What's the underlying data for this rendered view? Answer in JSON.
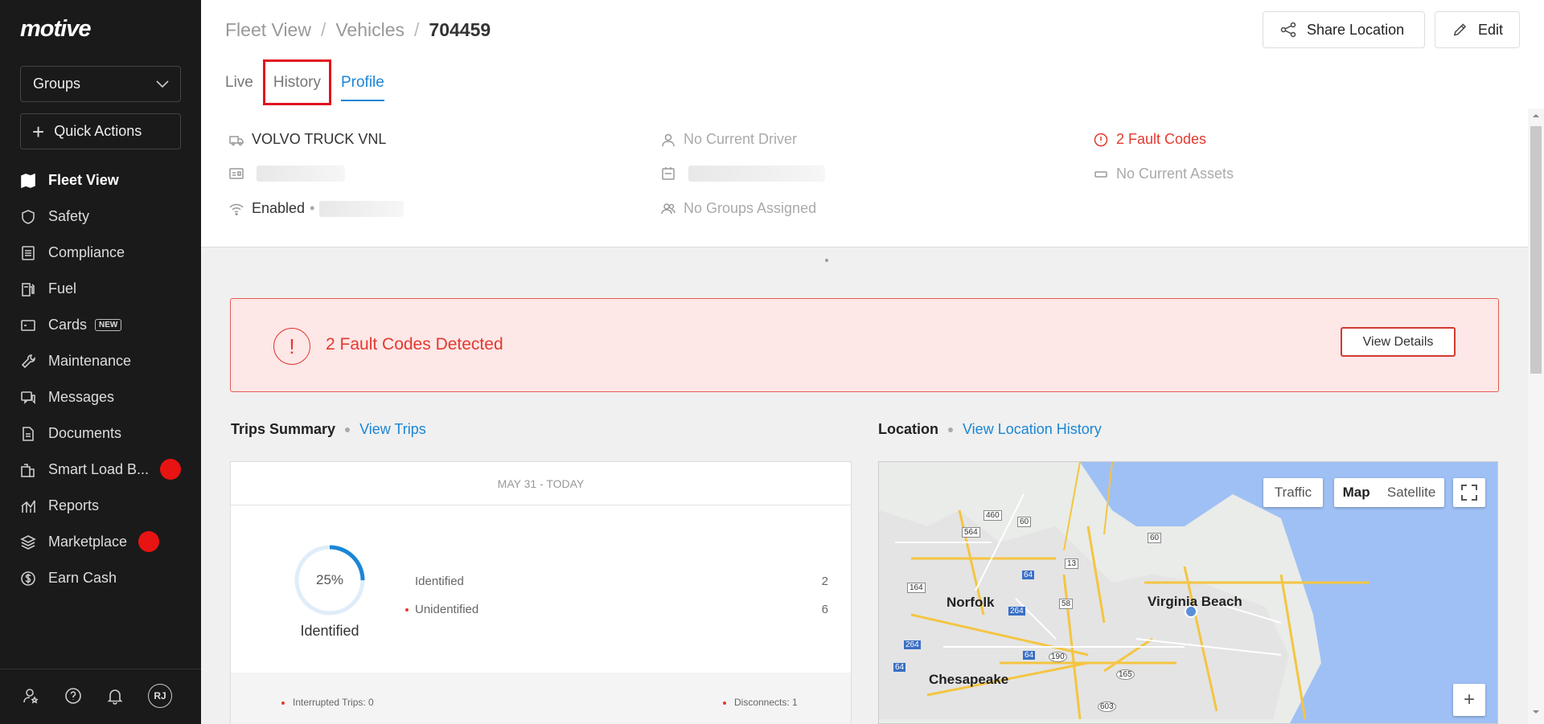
{
  "app": {
    "logo": "motive"
  },
  "sidebar": {
    "groups_label": "Groups",
    "quick_actions_label": "Quick Actions",
    "items": [
      {
        "label": "Fleet View",
        "icon": "map-icon",
        "active": true
      },
      {
        "label": "Safety",
        "icon": "shield-icon"
      },
      {
        "label": "Compliance",
        "icon": "document-list-icon"
      },
      {
        "label": "Fuel",
        "icon": "fuel-pump-icon"
      },
      {
        "label": "Cards",
        "icon": "card-icon",
        "badge": "NEW"
      },
      {
        "label": "Maintenance",
        "icon": "wrench-icon"
      },
      {
        "label": "Messages",
        "icon": "messages-icon"
      },
      {
        "label": "Documents",
        "icon": "file-icon"
      },
      {
        "label": "Smart Load B...",
        "icon": "load-board-icon",
        "dot": true
      },
      {
        "label": "Reports",
        "icon": "chart-icon"
      },
      {
        "label": "Marketplace",
        "icon": "layers-icon",
        "dot": true
      },
      {
        "label": "Earn Cash",
        "icon": "dollar-icon"
      }
    ],
    "avatar": "RJ"
  },
  "header": {
    "breadcrumb": [
      "Fleet View",
      "Vehicles",
      "704459"
    ],
    "share_label": "Share Location",
    "edit_label": "Edit",
    "tabs": [
      "Live",
      "History",
      "Profile"
    ],
    "active_tab": "Profile"
  },
  "info": {
    "vehicle": "VOLVO TRUCK VNL",
    "driver": "No Current Driver",
    "fault_codes": "2 Fault Codes",
    "assets": "No Current Assets",
    "connectivity": "Enabled",
    "groups": "No Groups Assigned"
  },
  "alert": {
    "text": "2 Fault Codes Detected",
    "icon": "!",
    "button": "View Details"
  },
  "trips": {
    "title": "Trips Summary",
    "link": "View Trips",
    "date_range": "MAY 31  -  TODAY",
    "percent": "25%",
    "percent_value": 0.25,
    "percent_label": "Identified",
    "stats": [
      {
        "label": "Identified",
        "value": "2"
      },
      {
        "label": "Unidentified",
        "value": "6"
      }
    ],
    "interrupted": "Interrupted Trips: 0",
    "disconnects": "Disconnects: 1"
  },
  "location": {
    "title": "Location",
    "link": "View Location History",
    "traffic": "Traffic",
    "map": "Map",
    "satellite": "Satellite",
    "zoom_in": "+",
    "cities": [
      "Norfolk",
      "Virginia Beach",
      "Chesapeake"
    ],
    "shields": [
      "460",
      "60",
      "564",
      "13",
      "60",
      "64",
      "164",
      "58",
      "264",
      "264",
      "64",
      "190",
      "64",
      "165",
      "603"
    ]
  },
  "colors": {
    "accent": "#1a86d6",
    "danger": "#e23a2f",
    "sidebar": "#1a1a1a"
  }
}
